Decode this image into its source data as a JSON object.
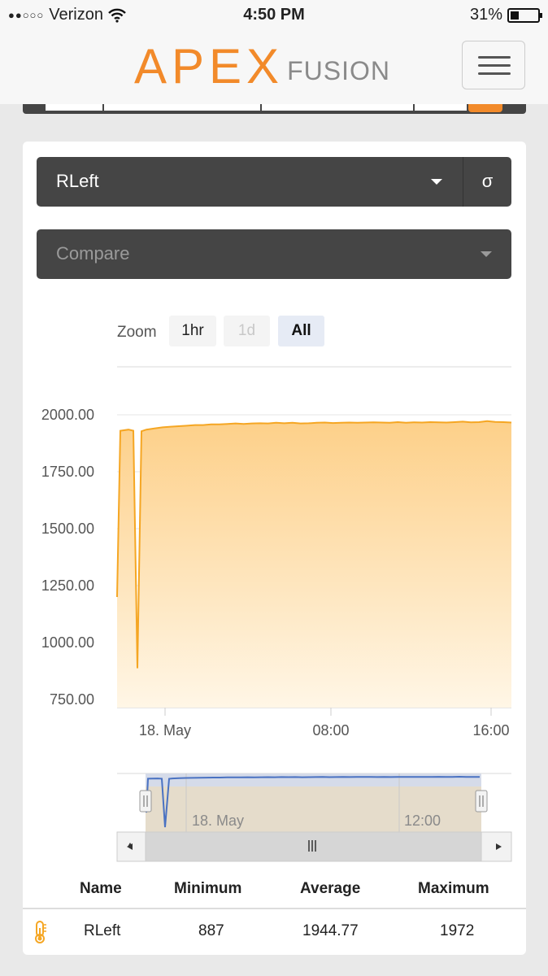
{
  "status": {
    "carrier": "Verizon",
    "signal": "●●○○○",
    "time": "4:50 PM",
    "battery": "31%"
  },
  "brand": {
    "apex": "APEX",
    "fusion": "FUSION",
    "accent": "#f28a2a"
  },
  "selector": {
    "value": "RLeft",
    "sigma": "σ"
  },
  "compare": {
    "placeholder": "Compare"
  },
  "zoom": {
    "label": "Zoom",
    "options": [
      "1hr",
      "1d",
      "All"
    ],
    "selected": "All"
  },
  "chart_data": {
    "type": "area",
    "yticks": [
      "2000.00",
      "1750.00",
      "1500.00",
      "1250.00",
      "1000.00",
      "750.00"
    ],
    "ylim": [
      750,
      2000
    ],
    "xticks": [
      "18. May",
      "08:00",
      "16:00"
    ],
    "series": [
      {
        "values": [
          1200,
          1930,
          1935,
          1930,
          887,
          1928,
          1935,
          1940,
          1945,
          1948,
          1950,
          1952,
          1955,
          1955,
          1958,
          1958,
          1960,
          1962,
          1960,
          1962,
          1963,
          1962,
          1965,
          1963,
          1965,
          1962,
          1963,
          1965,
          1966,
          1964,
          1965,
          1966,
          1965,
          1966,
          1967,
          1966,
          1965,
          1968,
          1965,
          1967,
          1966,
          1968,
          1967,
          1966,
          1968,
          1970,
          1967,
          1968,
          1972,
          1969,
          1968,
          1966
        ]
      }
    ],
    "navigator": {
      "xticks": [
        "18. May",
        "12:00"
      ]
    },
    "colors": {
      "line": "#f5a623",
      "fill_top": "#fdd089",
      "fill_bottom": "#fff6e6",
      "navigator_line": "#4a72c2"
    }
  },
  "table": {
    "headers": [
      "Name",
      "Minimum",
      "Average",
      "Maximum"
    ],
    "rows": [
      {
        "icon": "thermometer-icon",
        "name": "RLeft",
        "minimum": "887",
        "average": "1944.77",
        "maximum": "1972"
      }
    ]
  }
}
